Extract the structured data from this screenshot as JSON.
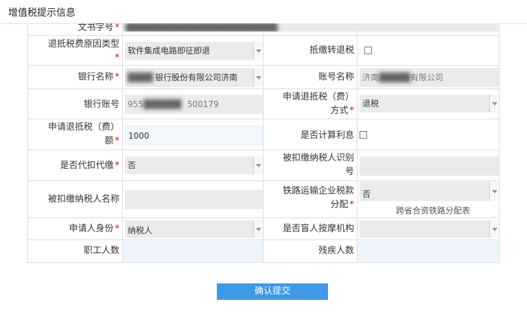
{
  "header": {
    "title": "增值税提示信息"
  },
  "form": {
    "doc_number_label": "文书字号",
    "doc_number_value": "████████████████████████",
    "refund_type_label": "退抵税费原因类型",
    "refund_type_value": "软件集成电路即征即退",
    "offset_refund_label": "抵缴转退税",
    "bank_name_label": "银行名称",
    "bank_name_value": "银行股份有限公司济南",
    "account_name_label": "账号名称",
    "account_name_prefix": "济南",
    "account_name_suffix": "有限公司",
    "bank_account_label": "银行账号",
    "bank_account_prefix": "955",
    "bank_account_suffix": "500179",
    "refund_method_label_1": "申请退抵税（费）",
    "refund_method_label_2": "方式",
    "refund_method_value": "退税",
    "refund_amount_label_1": "申请退抵税（费）",
    "refund_amount_label_2": "额",
    "refund_amount_value": "1000",
    "calc_interest_label": "是否计算利息",
    "withholding_label": "是否代扣代缴",
    "withholding_value": "否",
    "withheld_taxpayer_id_label_1": "被扣缴纳税人识别",
    "withheld_taxpayer_id_label_2": "号",
    "withheld_taxpayer_name_label": "被扣缴纳税人名称",
    "railway_alloc_label_1": "铁路运输企业税款",
    "railway_alloc_label_2": "分配",
    "railway_alloc_value": "否",
    "railway_alloc_note": "跨省合资铁路分配表",
    "applicant_identity_label": "申请人身份",
    "applicant_identity_value": "纳税人",
    "blind_massage_label": "是否盲人按摩机构",
    "employee_count_label": "职工人数",
    "disabled_count_label": "残疾人数",
    "required_mark": "*"
  },
  "actions": {
    "submit_label": "确认提交"
  },
  "colors": {
    "submit_bg": "#3e9ae6",
    "required": "#dd0000",
    "readonly_field": "#ebebeb"
  }
}
